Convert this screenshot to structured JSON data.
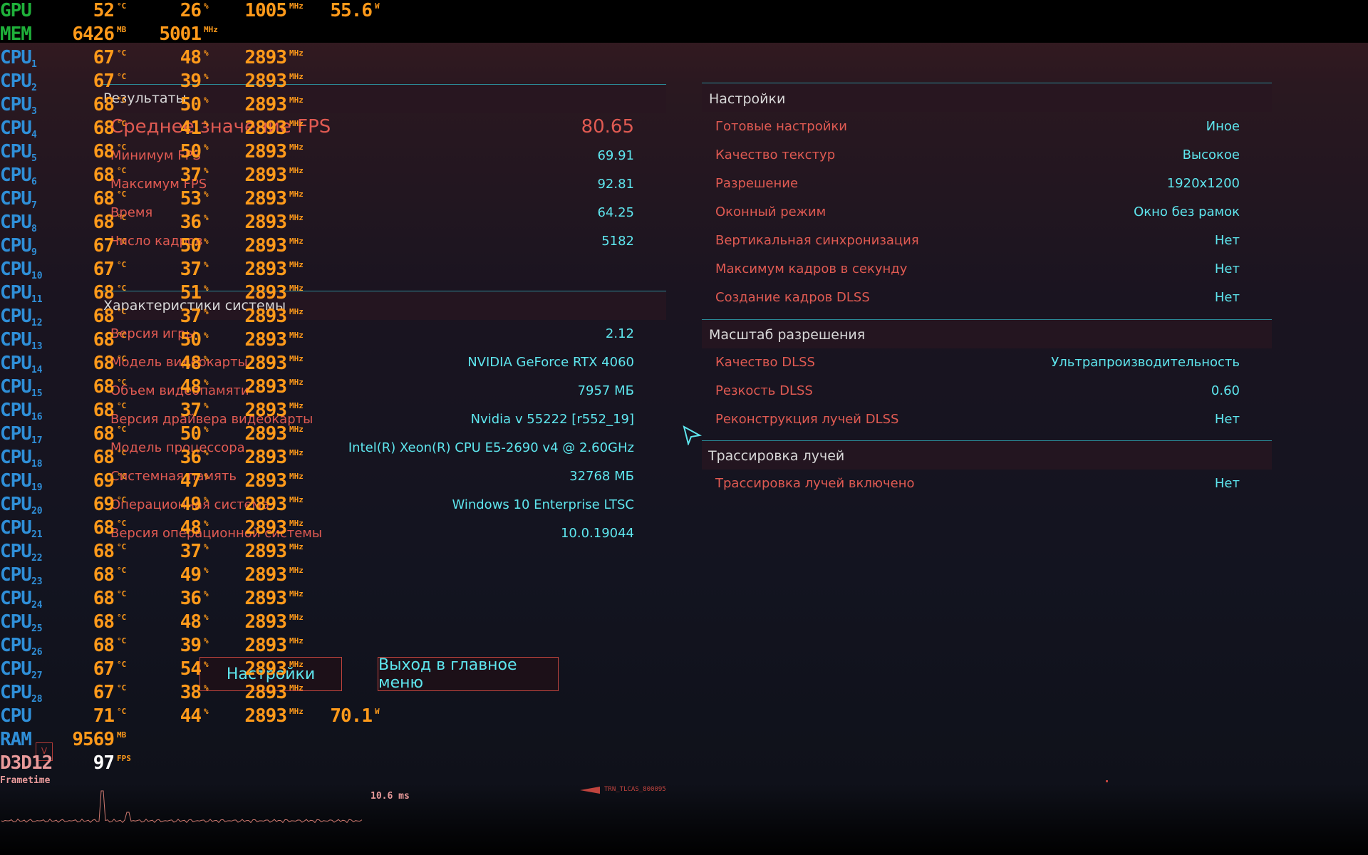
{
  "results": {
    "title": "Результаты",
    "rows": [
      {
        "label": "Среднее значение FPS",
        "value": "80.65"
      },
      {
        "label": "Минимум FPS",
        "value": "69.91"
      },
      {
        "label": "Максимум FPS",
        "value": "92.81"
      },
      {
        "label": "Время",
        "value": "64.25"
      },
      {
        "label": "Число кадров",
        "value": "5182"
      }
    ]
  },
  "system": {
    "title": "Характеристики системы",
    "rows": [
      {
        "label": "Версия игры",
        "value": "2.12"
      },
      {
        "label": "Модель видеокарты",
        "value": "NVIDIA GeForce RTX 4060"
      },
      {
        "label": "Объем видеопамяти",
        "value": "7957 МБ"
      },
      {
        "label": "Версия драйвера видеокарты",
        "value": "Nvidia v 55222 [r552_19]"
      },
      {
        "label": "Модель процессора",
        "value": "Intel(R) Xeon(R) CPU E5-2690 v4 @ 2.60GHz"
      },
      {
        "label": "Системная память",
        "value": "32768 МБ"
      },
      {
        "label": "Операционная система",
        "value": "Windows 10 Enterprise LTSC"
      },
      {
        "label": "Версия операционной системы",
        "value": "10.0.19044"
      }
    ]
  },
  "settings": {
    "title": "Настройки",
    "rows": [
      {
        "label": "Готовые настройки",
        "value": "Иное"
      },
      {
        "label": "Качество текстур",
        "value": "Высокое"
      },
      {
        "label": "Разрешение",
        "value": "1920x1200"
      },
      {
        "label": "Оконный режим",
        "value": "Окно без рамок"
      },
      {
        "label": "Вертикальная синхронизация",
        "value": "Нет"
      },
      {
        "label": "Максимум кадров в секунду",
        "value": "Нет"
      },
      {
        "label": "Создание кадров DLSS",
        "value": "Нет"
      }
    ]
  },
  "scaling": {
    "title": "Масштаб разрешения",
    "rows": [
      {
        "label": "Качество DLSS",
        "value": "Ультрапроизводительность"
      },
      {
        "label": "Резкость DLSS",
        "value": "0.60"
      },
      {
        "label": "Реконструкция лучей DLSS",
        "value": "Нет"
      }
    ]
  },
  "raytracing": {
    "title": "Трассировка лучей",
    "rows": [
      {
        "label": "Трассировка лучей включено",
        "value": "Нет"
      }
    ]
  },
  "buttons": {
    "settings": "Настройки",
    "exit": "Выход в главное меню"
  },
  "footer": {
    "arrow_text": "TRN_TLCAS_800095"
  },
  "osd": {
    "gpu": {
      "name": "GPU",
      "temp": "52",
      "temp_unit": "°C",
      "load": "26",
      "load_unit": "%",
      "clock": "1005",
      "clock_unit": "MHz",
      "power": "55.6",
      "power_unit": "W"
    },
    "mem": {
      "name": "MEM",
      "used": "6426",
      "used_unit": "MB",
      "clock": "5001",
      "clock_unit": "MHz"
    },
    "cpus": [
      {
        "n": "1",
        "temp": "67",
        "load": "48",
        "clock": "2893"
      },
      {
        "n": "2",
        "temp": "67",
        "load": "39",
        "clock": "2893"
      },
      {
        "n": "3",
        "temp": "68",
        "load": "50",
        "clock": "2893"
      },
      {
        "n": "4",
        "temp": "68",
        "load": "41",
        "clock": "2893"
      },
      {
        "n": "5",
        "temp": "68",
        "load": "50",
        "clock": "2893"
      },
      {
        "n": "6",
        "temp": "68",
        "load": "37",
        "clock": "2893"
      },
      {
        "n": "7",
        "temp": "68",
        "load": "53",
        "clock": "2893"
      },
      {
        "n": "8",
        "temp": "68",
        "load": "36",
        "clock": "2893"
      },
      {
        "n": "9",
        "temp": "67",
        "load": "50",
        "clock": "2893"
      },
      {
        "n": "10",
        "temp": "67",
        "load": "37",
        "clock": "2893"
      },
      {
        "n": "11",
        "temp": "68",
        "load": "51",
        "clock": "2893"
      },
      {
        "n": "12",
        "temp": "68",
        "load": "37",
        "clock": "2893"
      },
      {
        "n": "13",
        "temp": "68",
        "load": "50",
        "clock": "2893"
      },
      {
        "n": "14",
        "temp": "68",
        "load": "48",
        "clock": "2893"
      },
      {
        "n": "15",
        "temp": "68",
        "load": "48",
        "clock": "2893"
      },
      {
        "n": "16",
        "temp": "68",
        "load": "37",
        "clock": "2893"
      },
      {
        "n": "17",
        "temp": "68",
        "load": "50",
        "clock": "2893"
      },
      {
        "n": "18",
        "temp": "68",
        "load": "36",
        "clock": "2893"
      },
      {
        "n": "19",
        "temp": "69",
        "load": "47",
        "clock": "2893"
      },
      {
        "n": "20",
        "temp": "69",
        "load": "49",
        "clock": "2893"
      },
      {
        "n": "21",
        "temp": "68",
        "load": "48",
        "clock": "2893"
      },
      {
        "n": "22",
        "temp": "68",
        "load": "37",
        "clock": "2893"
      },
      {
        "n": "23",
        "temp": "68",
        "load": "49",
        "clock": "2893"
      },
      {
        "n": "24",
        "temp": "68",
        "load": "36",
        "clock": "2893"
      },
      {
        "n": "25",
        "temp": "68",
        "load": "48",
        "clock": "2893"
      },
      {
        "n": "26",
        "temp": "68",
        "load": "39",
        "clock": "2893"
      },
      {
        "n": "27",
        "temp": "67",
        "load": "54",
        "clock": "2893"
      },
      {
        "n": "28",
        "temp": "67",
        "load": "38",
        "clock": "2893"
      }
    ],
    "cpu_total": {
      "name": "CPU",
      "temp": "71",
      "load": "44",
      "clock": "2893",
      "power": "70.1"
    },
    "ram": {
      "name": "RAM",
      "used": "9569",
      "unit": "MB"
    },
    "d3d": {
      "name": "D3D12",
      "fps": "97",
      "unit": "FPS"
    },
    "frametime": {
      "label": "Frametime",
      "value": "10.6 ms"
    },
    "cpu_prefix": "CPU",
    "units": {
      "temp": "°C",
      "load": "%",
      "clock": "MHz",
      "power": "W"
    }
  },
  "colors": {
    "accent_cyan": "#5ee6ee",
    "label_red": "#e05a52",
    "osd_orange": "#ff9a1a",
    "osd_cpu_blue": "#2f8fd8",
    "osd_gpu_green": "#1fb03a"
  }
}
